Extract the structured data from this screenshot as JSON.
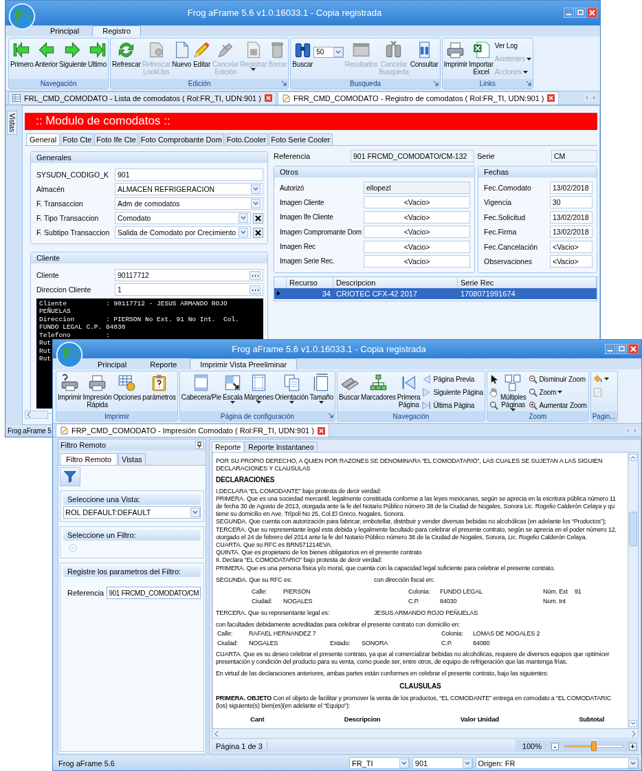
{
  "back_window": {
    "title": "Frog aFrame 5.6 v1.0.16033.1 - Copia registrada",
    "ribbon_tabs": [
      {
        "label": "Principal",
        "selected": false
      },
      {
        "label": "Registro",
        "selected": true
      }
    ],
    "ribbon_groups": [
      {
        "label": "Navegación",
        "launcher": false,
        "items": [
          {
            "kind": "large",
            "label": "Primero",
            "disabled": false,
            "dropdown": false
          },
          {
            "kind": "large",
            "label": "Anterior",
            "disabled": false,
            "dropdown": false
          },
          {
            "kind": "large",
            "label": "Siguiente",
            "disabled": false,
            "dropdown": false
          },
          {
            "kind": "large",
            "label": "Ultimo",
            "disabled": false,
            "dropdown": false
          }
        ]
      },
      {
        "label": "Edición",
        "launcher": true,
        "items": [
          {
            "kind": "large",
            "label": "Refrescar",
            "disabled": false,
            "dropdown": false
          },
          {
            "kind": "large",
            "label": "Refrescar LookUps",
            "disabled": true,
            "dropdown": false
          },
          {
            "kind": "large",
            "label": "Nuevo",
            "disabled": false,
            "dropdown": false
          },
          {
            "kind": "large",
            "label": "Editar",
            "disabled": false,
            "dropdown": false
          },
          {
            "kind": "large",
            "label": "Cancelar Edición",
            "disabled": true,
            "dropdown": false
          },
          {
            "kind": "large",
            "label": "Registrar",
            "disabled": true,
            "dropdown": true
          },
          {
            "kind": "large",
            "label": "Borrar",
            "disabled": true,
            "dropdown": false
          }
        ]
      },
      {
        "label": "Busqueda",
        "launcher": true,
        "items": [
          {
            "kind": "large",
            "label": "Buscar",
            "disabled": false,
            "dropdown": false
          },
          {
            "kind": "combo",
            "value": "50"
          },
          {
            "kind": "large",
            "label": "Resultados",
            "disabled": true,
            "dropdown": false
          },
          {
            "kind": "large",
            "label": "Cancelar Busqueda",
            "disabled": true,
            "dropdown": false
          },
          {
            "kind": "large",
            "label": "Consultar",
            "disabled": false,
            "dropdown": false
          }
        ]
      },
      {
        "label": "Links",
        "launcher": true,
        "items": [
          {
            "kind": "large",
            "label": "Imprimir",
            "disabled": false,
            "dropdown": false
          },
          {
            "kind": "large",
            "label": "Importar Excel",
            "disabled": false,
            "dropdown": false
          },
          {
            "kind": "stack",
            "items": [
              {
                "label": "Ver Log",
                "disabled": false,
                "dropdown": false
              },
              {
                "label": "Asistentes",
                "disabled": true,
                "dropdown": true
              },
              {
                "label": "Acciones",
                "disabled": true,
                "dropdown": true
              }
            ]
          }
        ]
      }
    ],
    "doc_tabs": [
      {
        "label": "FRL_CMD_COMODATO - Lista de comodatos ( Rol:FR_TI, UDN:901 )",
        "selected": false
      },
      {
        "label": "FRR_CMD_COMODATO - Registro de comodatos ( Rol:FR_TI, UDN:901 )",
        "selected": true
      }
    ],
    "side_tab": "Vistas",
    "module_title": ":: Modulo de comodatos ::",
    "form_tabs": [
      {
        "label": "General",
        "selected": true
      },
      {
        "label": "Foto Cte",
        "selected": false
      },
      {
        "label": "Foto Ife Cte",
        "selected": false
      },
      {
        "label": "Foto Comprobante Dom",
        "selected": false
      },
      {
        "label": "Foto.Cooler",
        "selected": false
      },
      {
        "label": "Foto Serie Cooler",
        "selected": false
      }
    ],
    "generales": {
      "title": "Generales",
      "fields": [
        {
          "label": "SYSUDN_CODIGO_K",
          "value": "901",
          "kind": "text"
        },
        {
          "label": "Almacén",
          "value": "ALMACEN  REFRIGERACION",
          "kind": "combo"
        },
        {
          "label": "F. Transaccion",
          "value": "Adm de comodatos",
          "kind": "combo"
        },
        {
          "label": "F. Tipo Transaccion",
          "value": "Comodato",
          "kind": "combo_clear"
        },
        {
          "label": "F. Subtipo Transaccion",
          "value": "Salida de Comodato por Crecimiento",
          "kind": "combo_clear"
        }
      ]
    },
    "cliente": {
      "title": "Cliente",
      "fields": [
        {
          "label": "Cliente",
          "value": "90117712",
          "kind": "lookup"
        },
        {
          "label": "Direccion Cliente",
          "value": "1",
          "kind": "lookup"
        }
      ],
      "terminal": [
        "Cliente          : 90117712 - JESUS ARMANDO ROJO",
        "PEÑUELAS",
        "Direccion        : PIERSON No Ext. 91 No Int.  Col.",
        "FUNDO LEGAL C.P. 84030",
        "Telefono         :",
        "Rut",
        "Rut",
        "Rut"
      ]
    },
    "referencia": {
      "label": "Referencia",
      "value": "901 FRCMD_COMODATO/CM-132"
    },
    "serie": {
      "label": "Serie",
      "value": "CM"
    },
    "otros": {
      "title": "Otros",
      "fields": [
        {
          "label": "Autorizó",
          "value": "ellopezl",
          "kind": "readonly"
        },
        {
          "label": "Imagen Cliente",
          "value": "<Vacio>",
          "kind": "image"
        },
        {
          "label": "Imagen Ife Cliente",
          "value": "<Vacio>",
          "kind": "image"
        },
        {
          "label": "Imagen Compromante Dom",
          "value": "<Vacio>",
          "kind": "image"
        },
        {
          "label": "Imagen Rec",
          "value": "<Vacio>",
          "kind": "image"
        },
        {
          "label": "Imagen Serie Rec.",
          "value": "<Vacio>",
          "kind": "image"
        }
      ]
    },
    "fechas": {
      "title": "Fechas",
      "fields": [
        {
          "label": "Fec.Comodato",
          "value": "13/02/2018",
          "kind": "text"
        },
        {
          "label": "Vigencia",
          "value": "30",
          "kind": "text"
        },
        {
          "label": "Fec.Solicitud",
          "value": "13/02/2018",
          "kind": "text"
        },
        {
          "label": "Fec.Firma",
          "value": "13/02/2018",
          "kind": "text"
        },
        {
          "label": "Fec.Cancelación",
          "value": "<Vacio>",
          "kind": "text"
        },
        {
          "label": "Observaciones",
          "value": "<Vacio>",
          "kind": "text"
        }
      ]
    },
    "grid": {
      "columns": [
        "Recurso",
        "Descripcion",
        "Serie Rec"
      ],
      "rows": [
        {
          "cells": [
            "34",
            "CRIOTEC CFX-42 2017",
            "1708071991674"
          ],
          "selected": true
        }
      ]
    },
    "status": "Frog aFrame 5"
  },
  "front_window": {
    "title": "Frog aFrame 5.6 v1.0.16033.1 - Copia registrada",
    "ribbon_tabs": [
      {
        "label": "Principal",
        "selected": false
      },
      {
        "label": "Reporte",
        "selected": false
      },
      {
        "label": "Imprimir Vista Preeliminar",
        "selected": true
      }
    ],
    "ribbon_groups": [
      {
        "label": "Imprimir",
        "launcher": false,
        "items": [
          {
            "kind": "large",
            "label": "Imprimir",
            "dropdown": false
          },
          {
            "kind": "large",
            "label": "Impresión Rápida",
            "dropdown": false
          },
          {
            "kind": "large",
            "label": "Opciones",
            "dropdown": false
          },
          {
            "kind": "large",
            "label": "parámetros",
            "dropdown": false
          }
        ]
      },
      {
        "label": "Página de configuración",
        "launcher": true,
        "items": [
          {
            "kind": "large",
            "label": "Cabecera/Pie",
            "dropdown": false
          },
          {
            "kind": "large",
            "label": "Escala",
            "dropdown": true
          },
          {
            "kind": "large",
            "label": "Márgenes",
            "dropdown": true
          },
          {
            "kind": "large",
            "label": "Orientación",
            "dropdown": true
          },
          {
            "kind": "large",
            "label": "Tamaño",
            "dropdown": true
          }
        ]
      },
      {
        "label": "Navegación",
        "launcher": false,
        "items": [
          {
            "kind": "large",
            "label": "Buscar",
            "dropdown": false
          },
          {
            "kind": "large",
            "label": "Marcadores",
            "dropdown": false
          },
          {
            "kind": "large",
            "label": "Primera Página",
            "dropdown": false
          },
          {
            "kind": "stack",
            "items": [
              {
                "label": "Página Previa",
                "dropdown": false
              },
              {
                "label": "Siguiente Página",
                "dropdown": false
              },
              {
                "label": "Última Página",
                "dropdown": false
              }
            ]
          }
        ]
      },
      {
        "label": "Zoom",
        "launcher": false,
        "items": [
          {
            "kind": "stack",
            "items": [
              {
                "dropdown": false
              },
              {
                "dropdown": false
              },
              {
                "dropdown": false
              }
            ]
          },
          {
            "kind": "large",
            "label": "Múltiples Páginas",
            "dropdown": true
          },
          {
            "kind": "stack",
            "items": [
              {
                "label": "Disminuir Zoom",
                "dropdown": false
              },
              {
                "label": "Zoom",
                "dropdown": true
              },
              {
                "label": "Aumentar Zoom",
                "dropdown": false
              }
            ]
          }
        ]
      },
      {
        "label": "Pagin...",
        "launcher": false,
        "items": [
          {
            "kind": "stack",
            "items": [
              {
                "dropdown": true
              },
              {
                "dropdown": false
              }
            ]
          }
        ]
      }
    ],
    "doc_tabs": [
      {
        "label": "FRP_CMD_COMODATO - Impresión Comodato ( Rol:FR_TI, UDN:901 )",
        "selected": true
      }
    ],
    "filter_panel": {
      "title": "Filtro Remoto",
      "tabs": [
        {
          "label": "Filtro Remoto",
          "selected": true
        },
        {
          "label": "Vistas",
          "selected": false
        }
      ],
      "vista": {
        "title": "Seleccione una Vista:",
        "value": "ROL DEFAULT:DEFAULT"
      },
      "filtro": {
        "title": "Seleccione un Filtro:",
        "radio": {
          "selected": false
        }
      },
      "params": {
        "title": "Registre los parametros del Filtro:",
        "fields": [
          {
            "label": "Referencia",
            "value": "901 FRCMD_COMODATO/CM"
          }
        ]
      }
    },
    "viewer": {
      "tabs": [
        {
          "label": "Reporte",
          "selected": true
        },
        {
          "label": "Reporte Instantaneo",
          "selected": false
        }
      ],
      "blocks": [
        {
          "kind": "text",
          "lines": [
            "POR SU PROPIO DERECHO, A QUIEN  POR RAZONES SE DENOMINARA “EL COMODATARIO”, LAS CUALES SE SUJETAN A LAS SIGUIEN",
            "DECLARACIONES Y CLAUSULAS"
          ]
        },
        {
          "kind": "heading",
          "text": "DECLARACIONES"
        },
        {
          "kind": "text",
          "lines": [
            "I.DECLARA “EL COMODANTE” bajo protesta de decir verdad:",
            "PRIMERA. Que es una sociedad mercantil, legalmente constituida conforme a las leyes mexicanas, según se aprecia en la escritura pública número  11",
            "de fecha 30 de Agosto de 2013, otorgada ante la fe del Notario Público número 38 de la Ciudad de Nogales, Sonora  Lic. Rogelio Calderón Celaya y qu",
            "tiene su domicilio en Ave. Trípoli No 25, Col.El Greco, Nogales, Sonora.",
            "SEGUNDA. Que cuenta con autorización para fabricar, embotellar, distribuir y vender diversas bebidas no alcohólicas (en adelante los “Productos”);",
            "TERCERA. Que su representante legal esta debida y legalmente facultado para celebrar el presente contrato, según se aprecia en  el poder número 12,",
            "otorgado el 24 de febrero del 2014 ante la fe del Notario Público número 38 de la Ciudad de Nogales, Sonora, Lic. Rogelio Calderón Celaya.",
            "CUARTA. Que su RFC es BRN571214EVA.",
            "QUINTA. Que es propietario de los bienes obligatorios en el presente contrato",
            "II. Declara “EL COMODATARIO” bajo protesta de decir verdad:",
            "PRIMERA. Que es una persona física y/o moral, que cuenta con la capacidad legal  suficiente para celebrar el presente contrato."
          ]
        },
        {
          "kind": "split",
          "left": "SEGUNDA. Que su RFC es:",
          "right": "con dirección fiscal en:"
        },
        {
          "kind": "fields_indented",
          "rows": [
            [
              {
                "label": "Calle:",
                "value": "PIERSON"
              },
              {
                "label": "Colonia:",
                "value": "FUNDO LEGAL"
              },
              {
                "label": "Núm. Ext",
                "value": "91"
              }
            ],
            [
              {
                "label": "Ciudad:",
                "value": "NOGALES"
              },
              {
                "label": "C.P.",
                "value": "84030"
              },
              {
                "label": "Num. Int"
              }
            ]
          ]
        },
        {
          "kind": "split",
          "left": "TERCERA. Que su representante legal es:",
          "right": "JESUS ARMANDO ROJO PEÑUELAS"
        },
        {
          "kind": "text",
          "lines": [
            "con facultades debidamente acreditadas para celebrar el presente contrato con domicilio en:"
          ]
        },
        {
          "kind": "fields",
          "rows": [
            [
              {
                "label": "Calle:",
                "value": "RAFAEL HERNANDEZ 7"
              },
              {},
              {
                "label": "Colonia:",
                "value": "LOMAS DE NOGALES 2"
              }
            ],
            [
              {
                "label": "Ciudad:",
                "value": "NOGALES"
              },
              {
                "label": "Estado:",
                "value": "SONORA"
              },
              {
                "label": "C.P.",
                "value": "84080"
              }
            ]
          ]
        },
        {
          "kind": "text",
          "lines": [
            "CUARTA. Que es su deseo celebrar el presente contrato, ya que al comercializar bebidas no alcohólicas, requiere de diversos equipos que optimicer",
            "presentación y condición del producto para su venta, como puede ser, entre otros, de equipo de refrigeración que las mantenga frías."
          ]
        },
        {
          "kind": "text",
          "lines": [
            "En virtud de las declaraciones anteriores, ambas partes están conformes en celebrar el presente contrato, bajo las siguientes:"
          ]
        },
        {
          "kind": "title",
          "text": "CLAUSULAS"
        },
        {
          "kind": "text",
          "lines": [
            "**PRIMERA. OBJETO** Con el objeto  de facilitar y promover la venta de los productos, “EL COMODANTE” entrega en comodato a “EL COMODATARIC",
            "(los) siguiente(s) bien(es)(en adelante el “Equipo”):"
          ]
        },
        {
          "kind": "columns",
          "cells": [
            "Cant",
            "Descripcion",
            "Valor Unidad",
            "Subtotal"
          ]
        }
      ],
      "page": "Página 1 de 3",
      "zoom": "100%",
      "zoom_minus": "-",
      "zoom_plus": "+",
      "zoom_slider": {
        "level": 0.5
      }
    },
    "status": {
      "label": "Frog aFrame 5.6",
      "combos": [
        "FR_TI",
        "901",
        "Origen: FR"
      ]
    }
  }
}
